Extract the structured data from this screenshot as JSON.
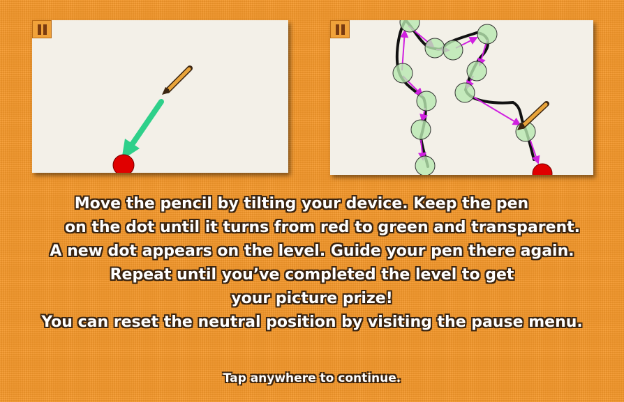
{
  "instructions": {
    "lines": [
      "Move the pencil by tilting your device. Keep the pen",
      "on the dot until it turns from red to green and transparent.",
      "A new dot appears on the level. Guide your pen there again.",
      "Repeat until you’ve completed the level to get",
      "your picture prize!",
      "You can reset the neutral position by visiting the pause menu."
    ],
    "tap_to_continue": "Tap anywhere to continue."
  },
  "colors": {
    "background": "#f5982a",
    "target_dot": "#e00000",
    "completed_dot": "#b8e8b0",
    "tilt_arrow": "#2ed08a",
    "path_arrow": "#d020e0",
    "pause_icon": "#7a3b10"
  },
  "icons": [
    "pause-icon",
    "pencil-icon",
    "tilt-arrow-icon",
    "red-dot-icon",
    "green-dot-icon"
  ]
}
